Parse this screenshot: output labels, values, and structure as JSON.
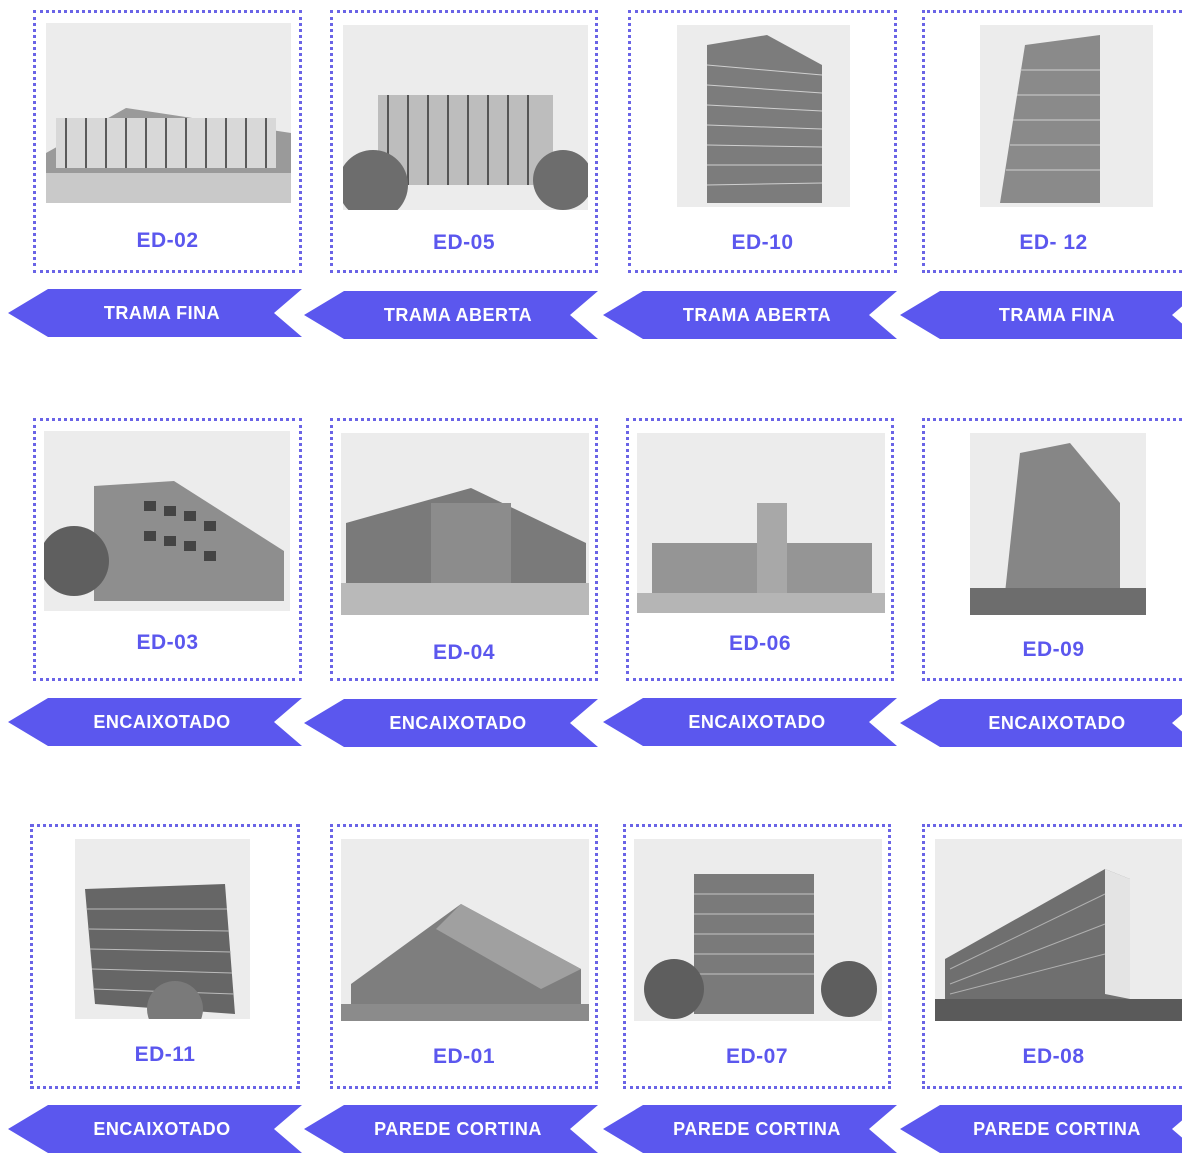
{
  "accent_color": "#5b57ee",
  "rows": [
    {
      "cards": [
        {
          "code": "ED-02",
          "tag": "TRAMA FINA",
          "image": "building-photo"
        },
        {
          "code": "ED-05",
          "tag": "TRAMA ABERTA",
          "image": "building-photo"
        },
        {
          "code": "ED-10",
          "tag": "TRAMA ABERTA",
          "image": "building-photo"
        },
        {
          "code": "ED- 12",
          "tag": "TRAMA FINA",
          "image": "building-photo"
        }
      ]
    },
    {
      "cards": [
        {
          "code": "ED-03",
          "tag": "ENCAIXOTADO",
          "image": "building-photo"
        },
        {
          "code": "ED-04",
          "tag": "ENCAIXOTADO",
          "image": "building-photo"
        },
        {
          "code": "ED-06",
          "tag": "ENCAIXOTADO",
          "image": "building-photo"
        },
        {
          "code": "ED-09",
          "tag": "ENCAIXOTADO",
          "image": "building-photo"
        }
      ]
    },
    {
      "cards": [
        {
          "code": "ED-11",
          "tag": "ENCAIXOTADO",
          "image": "building-photo"
        },
        {
          "code": "ED-01",
          "tag": "PAREDE CORTINA",
          "image": "building-photo"
        },
        {
          "code": "ED-07",
          "tag": "PAREDE CORTINA",
          "image": "building-photo"
        },
        {
          "code": "ED-08",
          "tag": "PAREDE CORTINA",
          "image": "building-photo"
        }
      ]
    }
  ]
}
